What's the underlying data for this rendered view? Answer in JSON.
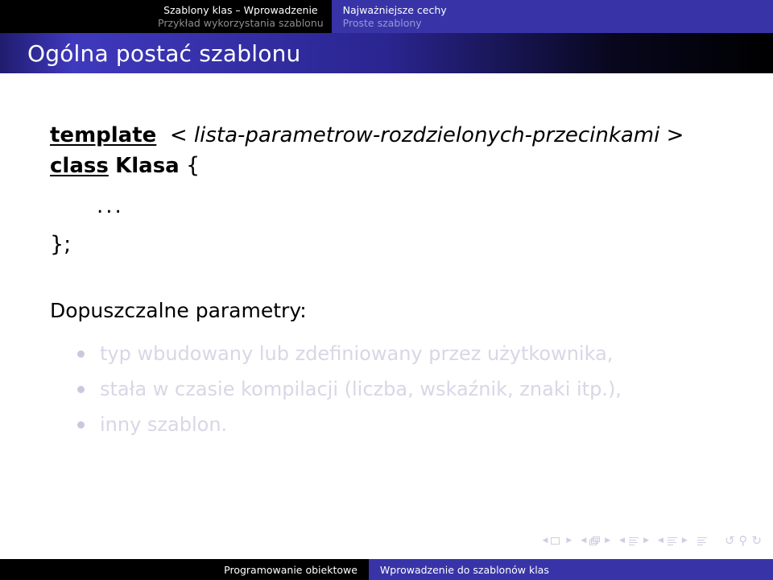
{
  "nav_header": {
    "sections": [
      {
        "title": "Szablony klas – Wprowadzenie",
        "subtitle": "Przykład wykorzystania szablonu",
        "state": "inactive"
      },
      {
        "title": "Najważniejsze cechy",
        "subtitle": "Proste szablony",
        "state": "active"
      }
    ]
  },
  "frame": {
    "title": "Ogólna postać szablonu"
  },
  "code": {
    "line1": {
      "keyword": "template",
      "open_angle": "<",
      "parameter": "lista-parametrow-rozdzielonych-przecinkami",
      "close_angle": ">"
    },
    "line2": {
      "keyword": "class",
      "identifier": "Klasa",
      "brace": "{"
    },
    "line3": "...",
    "line4": "};"
  },
  "content": {
    "lead": "Dopuszczalne parametry:",
    "bullets": [
      "typ wbudowany lub zdefiniowany przez użytkownika,",
      "stała w czasie kompilacji (liczba, wskaźnik, znaki itp.),",
      "inny szablon."
    ]
  },
  "nav_symbols": {
    "prev_label": "◀",
    "next_label": "▶",
    "icons": [
      "slide-icon",
      "frames-icon",
      "subsection-icon",
      "section-icon",
      "presentation-icon"
    ],
    "back_label": "↺",
    "search_label": "⚲",
    "forward_label": "↻"
  },
  "footer": {
    "course": "Programowanie obiektowe",
    "topic": "Wprowadzenie do szablonów klas"
  },
  "colors": {
    "accent_blue": "#3834a8",
    "black": "#000000",
    "title_gradient_start": "#3f39bd",
    "dim_text": "#d7d7e6",
    "nav_symbol": "#cdcde2"
  }
}
